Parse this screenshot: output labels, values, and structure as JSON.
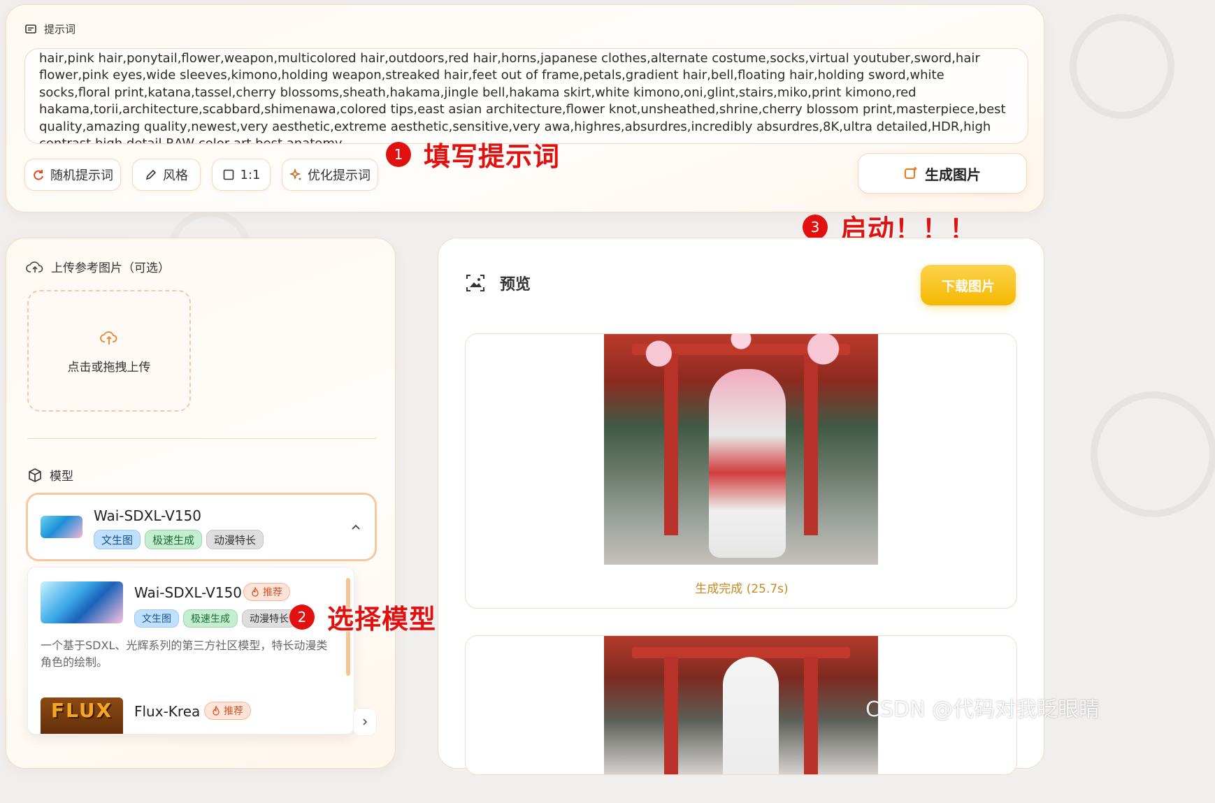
{
  "prompt_section": {
    "label": "提示词",
    "text": "hair,pink hair,ponytail,flower,weapon,multicolored hair,outdoors,red hair,horns,japanese clothes,alternate costume,socks,virtual youtuber,sword,hair flower,pink eyes,wide sleeves,kimono,holding weapon,streaked hair,feet out of frame,petals,gradient hair,bell,floating hair,holding sword,white socks,floral print,katana,tassel,cherry blossoms,sheath,hakama,jingle bell,hakama skirt,white kimono,oni,glint,stairs,miko,print kimono,red hakama,torii,architecture,scabbard,shimenawa,colored tips,east asian architecture,flower knot,unsheathed,shrine,cherry blossom print,masterpiece,best quality,amazing quality,newest,very aesthetic,extreme aesthetic,sensitive,very awa,highres,absurdres,incredibly absurdres,8K,ultra detailed,HDR,high contrast,high detail RAW color art,best anatomy,"
  },
  "toolbar": {
    "random_label": "随机提示词",
    "style_label": "风格",
    "ratio_label": "1:1",
    "optimize_label": "优化提示词",
    "generate_label": "生成图片"
  },
  "annotations": {
    "a1_num": "1",
    "a1_text": "填写提示词",
    "a2_num": "2",
    "a2_text": "选择模型",
    "a3_num": "3",
    "a3_text": "启动！！！"
  },
  "upload": {
    "label": "上传参考图片（可选）",
    "hint": "点击或拖拽上传"
  },
  "model": {
    "label": "模型",
    "selected_name": "Wai-SDXL-V150",
    "selected_tags": [
      "文生图",
      "极速生成",
      "动漫特长"
    ],
    "options": [
      {
        "name": "Wai-SDXL-V150",
        "badge": "推荐",
        "tags": [
          "文生图",
          "极速生成",
          "动漫特长"
        ],
        "description": "一个基于SDXL、光辉系列的第三方社区模型，特长动漫类角色的绘制。"
      },
      {
        "name": "Flux-Krea",
        "badge": "推荐",
        "thumb_text": "FLUX"
      }
    ]
  },
  "preview": {
    "title": "预览",
    "download_label": "下载图片",
    "status": "生成完成 (25.7s)"
  },
  "watermark": "CSDN @代码对我眨眼睛",
  "colors": {
    "accent": "#f5b800",
    "annotation_red": "#e0110f",
    "border": "#f3dcc6",
    "status_text": "#c98a1e"
  }
}
